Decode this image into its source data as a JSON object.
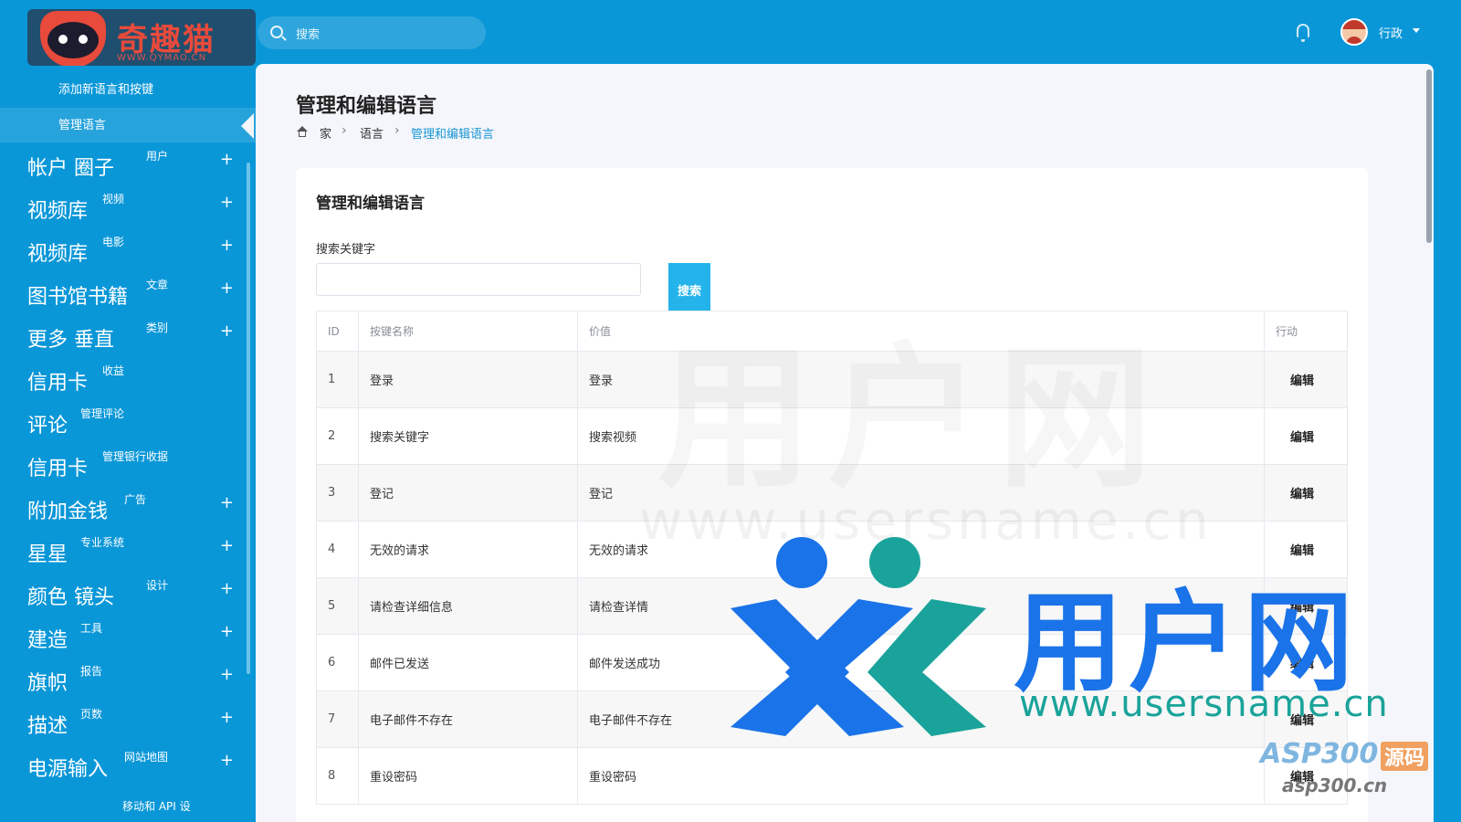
{
  "logo": {
    "name": "奇趣猫",
    "url": "WWW.QYMAO.CN"
  },
  "search": {
    "placeholder": "搜索"
  },
  "user": {
    "name": "行政"
  },
  "sidebar": {
    "sub_items": [
      {
        "label": "添加新语言和按键"
      },
      {
        "label": "管理语言"
      }
    ],
    "items": [
      {
        "label": "帐户   圈子",
        "sub": "用户",
        "plus": true
      },
      {
        "label": "视频库",
        "sub": "视频",
        "plus": true
      },
      {
        "label": "视频库",
        "sub": "电影",
        "plus": true
      },
      {
        "label": "图书馆书籍",
        "sub": "文章",
        "plus": true
      },
      {
        "label": "更多   垂直",
        "sub": "类别",
        "plus": true
      },
      {
        "label": "信用卡",
        "sub": "收益",
        "plus": false
      },
      {
        "label": "评论",
        "sub": "管理评论",
        "plus": false
      },
      {
        "label": "信用卡",
        "sub": "管理银行收据",
        "plus": false
      },
      {
        "label": "附加金钱",
        "sub": "广告",
        "plus": true
      },
      {
        "label": "星星",
        "sub": "专业系统",
        "plus": true
      },
      {
        "label": "颜色   镜头",
        "sub": "设计",
        "plus": true
      },
      {
        "label": "建造",
        "sub": "工具",
        "plus": true
      },
      {
        "label": "旗帜",
        "sub": "报告",
        "plus": true
      },
      {
        "label": "描述",
        "sub": "页数",
        "plus": true
      },
      {
        "label": "电源输入",
        "sub": "网站地图",
        "plus": true
      }
    ],
    "bottom_label": "移动和 API 设"
  },
  "page": {
    "title": "管理和编辑语言",
    "breadcrumb": {
      "home": "家",
      "section": "语言",
      "current": "管理和编辑语言"
    }
  },
  "card": {
    "title": "管理和编辑语言",
    "search_label": "搜索关键字",
    "search_value": "",
    "search_button": "搜索"
  },
  "table": {
    "headers": {
      "id": "ID",
      "key": "按键名称",
      "value": "价值",
      "action": "行动"
    },
    "rows": [
      {
        "id": "1",
        "key": "登录",
        "value": "登录",
        "action": "编辑"
      },
      {
        "id": "2",
        "key": "搜索关键字",
        "value": "搜索视频",
        "action": "编辑"
      },
      {
        "id": "3",
        "key": "登记",
        "value": "登记",
        "action": "编辑"
      },
      {
        "id": "4",
        "key": "无效的请求",
        "value": "无效的请求",
        "action": "编辑"
      },
      {
        "id": "5",
        "key": "请检查详细信息",
        "value": "请检查详情",
        "action": "编辑"
      },
      {
        "id": "6",
        "key": "邮件已发送",
        "value": "邮件发送成功",
        "action": "编辑"
      },
      {
        "id": "7",
        "key": "电子邮件不存在",
        "value": "电子邮件不存在",
        "action": "编辑"
      },
      {
        "id": "8",
        "key": "重设密码",
        "value": "重设密码",
        "action": "编辑"
      }
    ]
  },
  "watermark": {
    "brand": "用户网",
    "url": "www.usersname.cn",
    "faint_text": "www.usersname.cn",
    "faint_big": "用户网",
    "asp": "ASP300",
    "asp_tag": "源码",
    "asp_url": "asp300.cn"
  },
  "colors": {
    "primary": "#0a97d8",
    "button": "#24b3ea",
    "crumb_active": "#1a96d4"
  }
}
